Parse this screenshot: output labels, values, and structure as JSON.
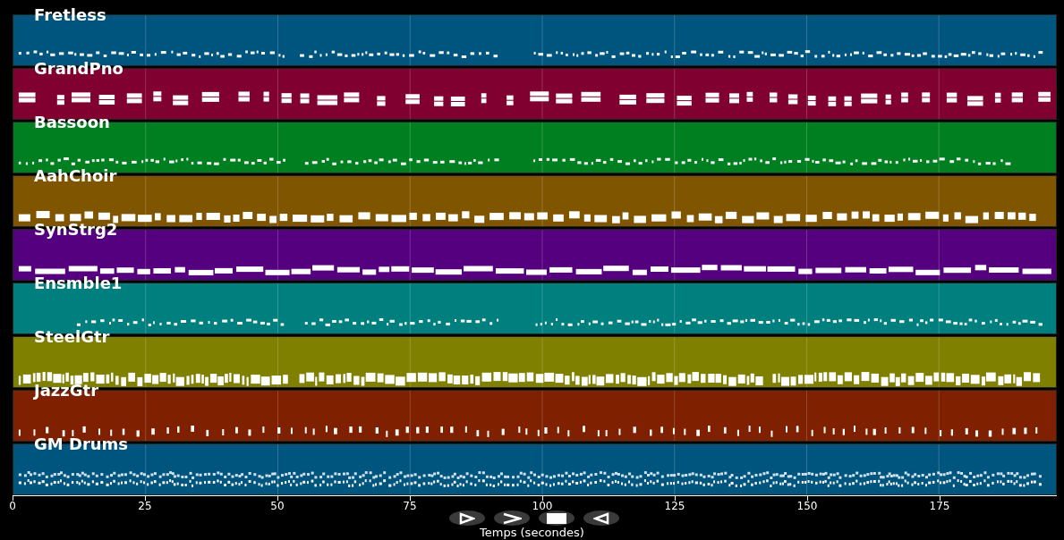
{
  "tracks": [
    {
      "name": "Fretless",
      "color": "#00557f",
      "kind": "dashes"
    },
    {
      "name": "GrandPno",
      "color": "#80002f",
      "kind": "chords"
    },
    {
      "name": "Bassoon",
      "color": "#007f20",
      "kind": "dashes"
    },
    {
      "name": "AahChoir",
      "color": "#7f5500",
      "kind": "blocks"
    },
    {
      "name": "SynStrg2",
      "color": "#55007f",
      "kind": "long"
    },
    {
      "name": "Ensmble1",
      "color": "#007f7f",
      "kind": "dashes"
    },
    {
      "name": "SteelGtr",
      "color": "#7f7f00",
      "kind": "dense"
    },
    {
      "name": "JazzGtr",
      "color": "#7f2000",
      "kind": "stabs"
    },
    {
      "name": "GM Drums",
      "color": "#00557f",
      "kind": "drums"
    }
  ],
  "x_axis": {
    "ticks": [
      "0",
      "25",
      "50",
      "75",
      "100",
      "125",
      "150",
      "175"
    ],
    "label": "Temps (secondes)"
  },
  "controls": [
    {
      "kind": "play"
    },
    {
      "kind": "forward"
    },
    {
      "kind": "stop"
    },
    {
      "kind": "back"
    }
  ]
}
